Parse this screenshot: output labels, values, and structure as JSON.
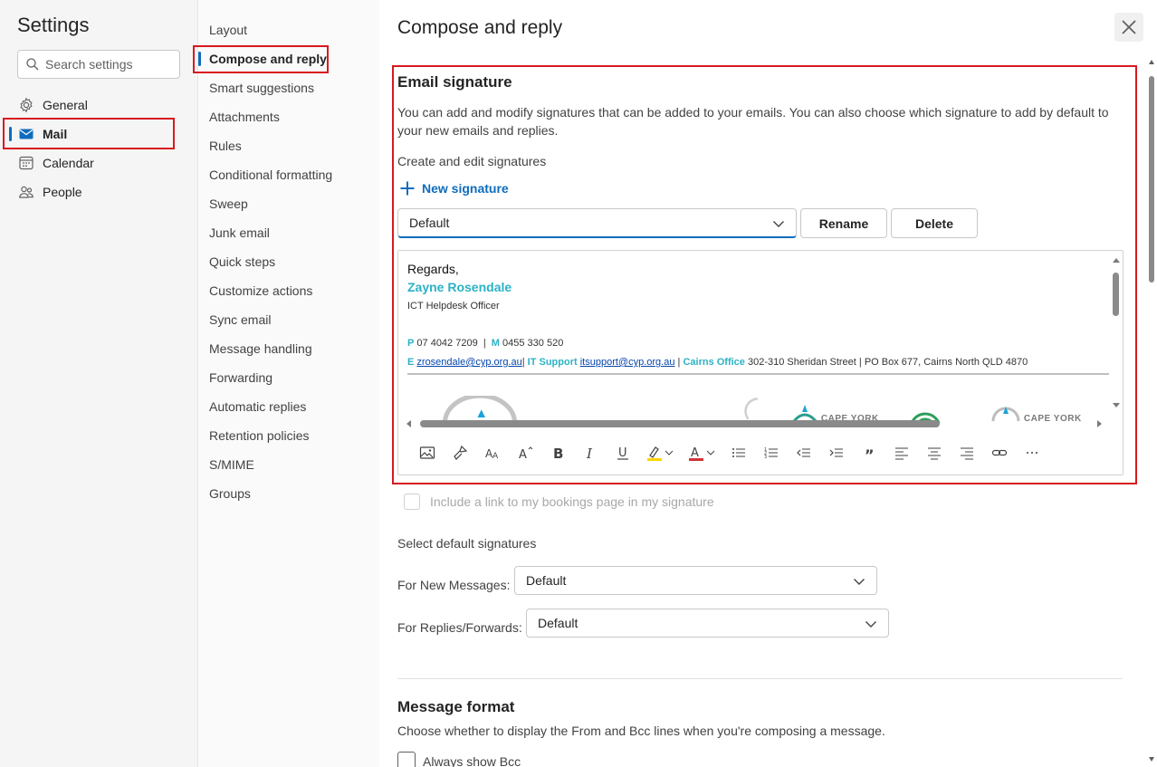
{
  "app": {
    "title": "Settings"
  },
  "search": {
    "placeholder": "Search settings"
  },
  "nav": [
    {
      "label": "General",
      "icon": "gear-icon"
    },
    {
      "label": "Mail",
      "icon": "mail-icon",
      "active": true
    },
    {
      "label": "Calendar",
      "icon": "calendar-icon"
    },
    {
      "label": "People",
      "icon": "people-icon"
    }
  ],
  "subnav": [
    "Layout",
    "Compose and reply",
    "Smart suggestions",
    "Attachments",
    "Rules",
    "Conditional formatting",
    "Sweep",
    "Junk email",
    "Quick steps",
    "Customize actions",
    "Sync email",
    "Message handling",
    "Forwarding",
    "Automatic replies",
    "Retention policies",
    "S/MIME",
    "Groups"
  ],
  "subnav_active_index": 1,
  "panel": {
    "title": "Compose and reply",
    "email_signature": {
      "title": "Email signature",
      "description": "You can add and modify signatures that can be added to your emails. You can also choose which signature to add by default to your new emails and replies.",
      "create_label": "Create and edit signatures",
      "new_signature": "New signature",
      "selected": "Default",
      "rename": "Rename",
      "delete": "Delete",
      "signature": {
        "regards": "Regards,",
        "name": "Zayne Rosendale",
        "role": "ICT Helpdesk Officer",
        "phone_label": "P",
        "phone": "07 4042 7209",
        "mobile_label": "M",
        "mobile": "0455 330 520",
        "email_label": "E",
        "email": "zrosendale@cyp.org.au",
        "support_label": "IT Support",
        "support_email": "itsupport@cyp.org.au",
        "office_label": "Cairns Office",
        "office_address": "302-310 Sheridan Street | PO Box 677, Cairns North QLD 4870",
        "logo_text_1": "CAPE YORK",
        "logo_text_2": "CAPE YORK"
      },
      "bookings_label": "Include a link to my bookings page in my signature"
    },
    "default_signatures": {
      "title": "Select default signatures",
      "new_label": "For New Messages:",
      "new_value": "Default",
      "reply_label": "For Replies/Forwards:",
      "reply_value": "Default"
    },
    "message_format": {
      "title": "Message format",
      "description": "Choose whether to display the From and Bcc lines when you're composing a message.",
      "always_bcc": "Always show Bcc"
    }
  },
  "colors": {
    "accent": "#0f6cbd",
    "highlight": "#d71920",
    "signature_teal": "#2bb2c5"
  }
}
